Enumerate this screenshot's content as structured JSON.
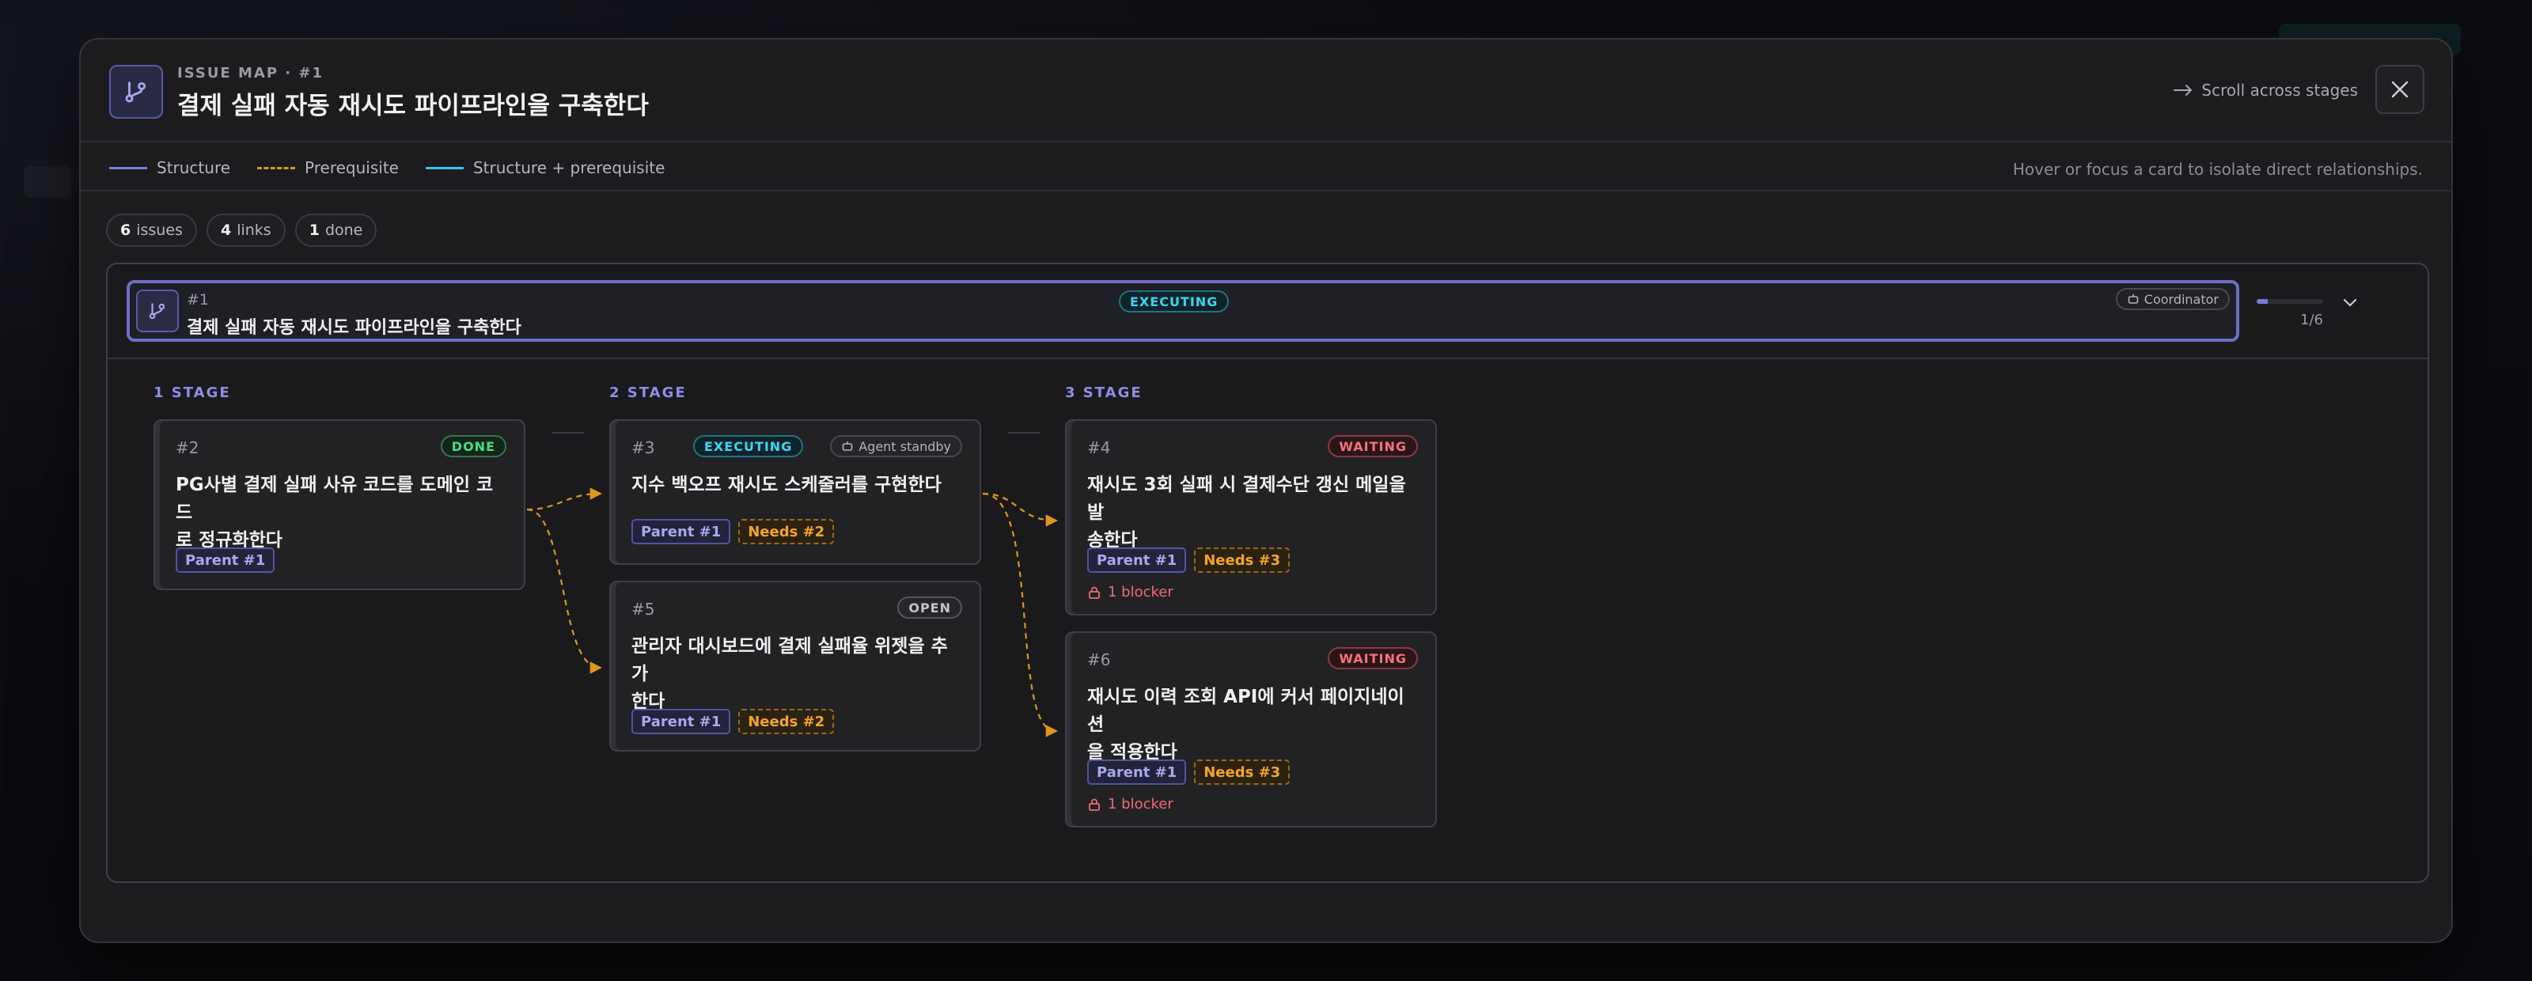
{
  "header": {
    "kicker": "ISSUE MAP · #1",
    "title": "결제 실패 자동 재시도 파이프라인을 구축한다",
    "scroll_hint": "Scroll across stages"
  },
  "legend": {
    "structure": "Structure",
    "prerequisite": "Prerequisite",
    "both": "Structure + prerequisite",
    "hint": "Hover or focus a card to isolate direct relationships.",
    "colors": {
      "structure": "#7d7de0",
      "prerequisite": "#e0971a",
      "both": "#38c4f0"
    }
  },
  "stats": {
    "issues_count": "6",
    "issues_label": "issues",
    "links_count": "4",
    "links_label": "links",
    "done_count": "1",
    "done_label": "done"
  },
  "root": {
    "num": "#1",
    "title": "결제 실패 자동 재시도 파이프라인을 구축한다",
    "status": "EXECUTING",
    "coordinator": "Coordinator",
    "progress_label": "1/6",
    "progress_fraction": 0.167
  },
  "stages": [
    "1 STAGE",
    "2 STAGE",
    "3 STAGE"
  ],
  "cards": {
    "c2": {
      "num": "#2",
      "status": "DONE",
      "title_l1": "PG사별 결제 실패 사유 코드를 도메인 코드",
      "title_l2": "로 정규화한다",
      "parent": "Parent #1"
    },
    "c3": {
      "num": "#3",
      "status": "EXECUTING",
      "agent": "Agent standby",
      "title_l1": "지수 백오프 재시도 스케줄러를 구현한다",
      "parent": "Parent #1",
      "needs": "Needs #2"
    },
    "c5": {
      "num": "#5",
      "status": "OPEN",
      "title_l1": "관리자 대시보드에 결제 실패율 위젯을 추가",
      "title_l2": "한다",
      "parent": "Parent #1",
      "needs": "Needs #2"
    },
    "c4": {
      "num": "#4",
      "status": "WAITING",
      "title_l1": "재시도 3회 실패 시 결제수단 갱신 메일을 발",
      "title_l2": "송한다",
      "parent": "Parent #1",
      "needs": "Needs #3",
      "blocker": "1 blocker"
    },
    "c6": {
      "num": "#6",
      "status": "WAITING",
      "title_l1": "재시도 이력 조회 API에 커서 페이지네이션",
      "title_l2": "을 적용한다",
      "parent": "Parent #1",
      "needs": "Needs #3",
      "blocker": "1 blocker"
    }
  }
}
